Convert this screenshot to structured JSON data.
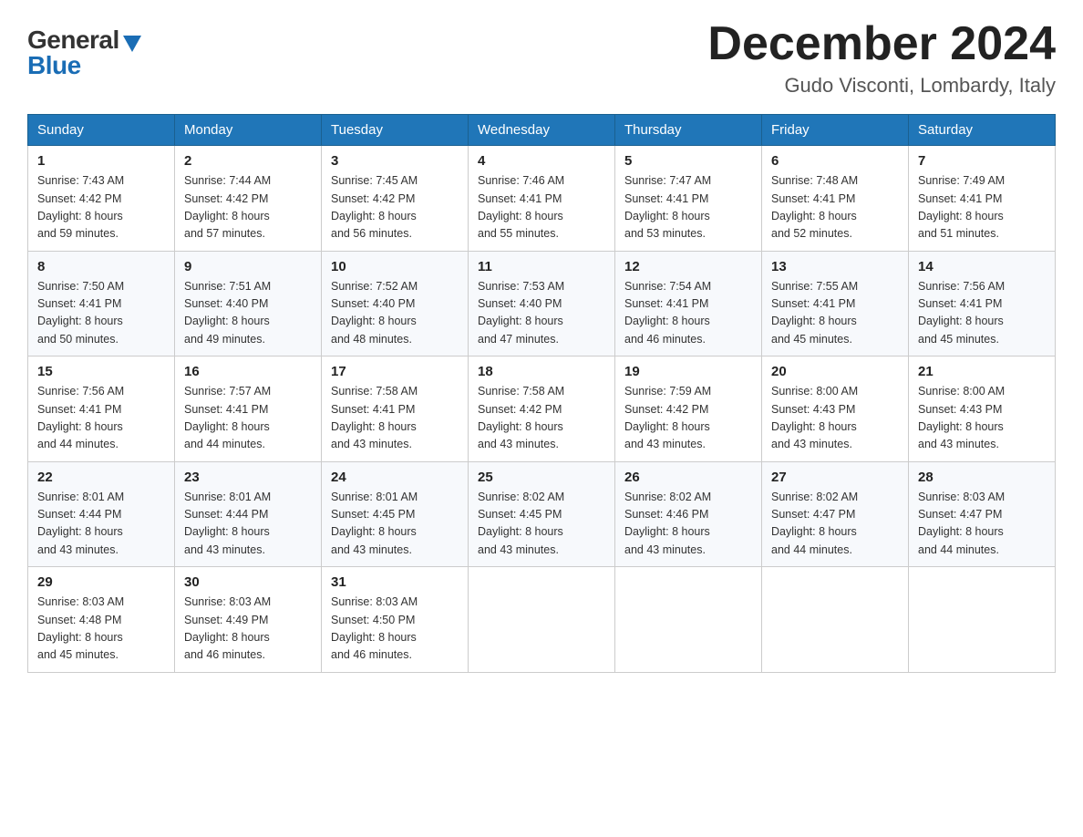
{
  "logo": {
    "general": "General",
    "blue": "Blue"
  },
  "header": {
    "month": "December 2024",
    "location": "Gudo Visconti, Lombardy, Italy"
  },
  "weekdays": [
    "Sunday",
    "Monday",
    "Tuesday",
    "Wednesday",
    "Thursday",
    "Friday",
    "Saturday"
  ],
  "weeks": [
    [
      {
        "day": "1",
        "sunrise": "Sunrise: 7:43 AM",
        "sunset": "Sunset: 4:42 PM",
        "daylight": "Daylight: 8 hours and 59 minutes."
      },
      {
        "day": "2",
        "sunrise": "Sunrise: 7:44 AM",
        "sunset": "Sunset: 4:42 PM",
        "daylight": "Daylight: 8 hours and 57 minutes."
      },
      {
        "day": "3",
        "sunrise": "Sunrise: 7:45 AM",
        "sunset": "Sunset: 4:42 PM",
        "daylight": "Daylight: 8 hours and 56 minutes."
      },
      {
        "day": "4",
        "sunrise": "Sunrise: 7:46 AM",
        "sunset": "Sunset: 4:41 PM",
        "daylight": "Daylight: 8 hours and 55 minutes."
      },
      {
        "day": "5",
        "sunrise": "Sunrise: 7:47 AM",
        "sunset": "Sunset: 4:41 PM",
        "daylight": "Daylight: 8 hours and 53 minutes."
      },
      {
        "day": "6",
        "sunrise": "Sunrise: 7:48 AM",
        "sunset": "Sunset: 4:41 PM",
        "daylight": "Daylight: 8 hours and 52 minutes."
      },
      {
        "day": "7",
        "sunrise": "Sunrise: 7:49 AM",
        "sunset": "Sunset: 4:41 PM",
        "daylight": "Daylight: 8 hours and 51 minutes."
      }
    ],
    [
      {
        "day": "8",
        "sunrise": "Sunrise: 7:50 AM",
        "sunset": "Sunset: 4:41 PM",
        "daylight": "Daylight: 8 hours and 50 minutes."
      },
      {
        "day": "9",
        "sunrise": "Sunrise: 7:51 AM",
        "sunset": "Sunset: 4:40 PM",
        "daylight": "Daylight: 8 hours and 49 minutes."
      },
      {
        "day": "10",
        "sunrise": "Sunrise: 7:52 AM",
        "sunset": "Sunset: 4:40 PM",
        "daylight": "Daylight: 8 hours and 48 minutes."
      },
      {
        "day": "11",
        "sunrise": "Sunrise: 7:53 AM",
        "sunset": "Sunset: 4:40 PM",
        "daylight": "Daylight: 8 hours and 47 minutes."
      },
      {
        "day": "12",
        "sunrise": "Sunrise: 7:54 AM",
        "sunset": "Sunset: 4:41 PM",
        "daylight": "Daylight: 8 hours and 46 minutes."
      },
      {
        "day": "13",
        "sunrise": "Sunrise: 7:55 AM",
        "sunset": "Sunset: 4:41 PM",
        "daylight": "Daylight: 8 hours and 45 minutes."
      },
      {
        "day": "14",
        "sunrise": "Sunrise: 7:56 AM",
        "sunset": "Sunset: 4:41 PM",
        "daylight": "Daylight: 8 hours and 45 minutes."
      }
    ],
    [
      {
        "day": "15",
        "sunrise": "Sunrise: 7:56 AM",
        "sunset": "Sunset: 4:41 PM",
        "daylight": "Daylight: 8 hours and 44 minutes."
      },
      {
        "day": "16",
        "sunrise": "Sunrise: 7:57 AM",
        "sunset": "Sunset: 4:41 PM",
        "daylight": "Daylight: 8 hours and 44 minutes."
      },
      {
        "day": "17",
        "sunrise": "Sunrise: 7:58 AM",
        "sunset": "Sunset: 4:41 PM",
        "daylight": "Daylight: 8 hours and 43 minutes."
      },
      {
        "day": "18",
        "sunrise": "Sunrise: 7:58 AM",
        "sunset": "Sunset: 4:42 PM",
        "daylight": "Daylight: 8 hours and 43 minutes."
      },
      {
        "day": "19",
        "sunrise": "Sunrise: 7:59 AM",
        "sunset": "Sunset: 4:42 PM",
        "daylight": "Daylight: 8 hours and 43 minutes."
      },
      {
        "day": "20",
        "sunrise": "Sunrise: 8:00 AM",
        "sunset": "Sunset: 4:43 PM",
        "daylight": "Daylight: 8 hours and 43 minutes."
      },
      {
        "day": "21",
        "sunrise": "Sunrise: 8:00 AM",
        "sunset": "Sunset: 4:43 PM",
        "daylight": "Daylight: 8 hours and 43 minutes."
      }
    ],
    [
      {
        "day": "22",
        "sunrise": "Sunrise: 8:01 AM",
        "sunset": "Sunset: 4:44 PM",
        "daylight": "Daylight: 8 hours and 43 minutes."
      },
      {
        "day": "23",
        "sunrise": "Sunrise: 8:01 AM",
        "sunset": "Sunset: 4:44 PM",
        "daylight": "Daylight: 8 hours and 43 minutes."
      },
      {
        "day": "24",
        "sunrise": "Sunrise: 8:01 AM",
        "sunset": "Sunset: 4:45 PM",
        "daylight": "Daylight: 8 hours and 43 minutes."
      },
      {
        "day": "25",
        "sunrise": "Sunrise: 8:02 AM",
        "sunset": "Sunset: 4:45 PM",
        "daylight": "Daylight: 8 hours and 43 minutes."
      },
      {
        "day": "26",
        "sunrise": "Sunrise: 8:02 AM",
        "sunset": "Sunset: 4:46 PM",
        "daylight": "Daylight: 8 hours and 43 minutes."
      },
      {
        "day": "27",
        "sunrise": "Sunrise: 8:02 AM",
        "sunset": "Sunset: 4:47 PM",
        "daylight": "Daylight: 8 hours and 44 minutes."
      },
      {
        "day": "28",
        "sunrise": "Sunrise: 8:03 AM",
        "sunset": "Sunset: 4:47 PM",
        "daylight": "Daylight: 8 hours and 44 minutes."
      }
    ],
    [
      {
        "day": "29",
        "sunrise": "Sunrise: 8:03 AM",
        "sunset": "Sunset: 4:48 PM",
        "daylight": "Daylight: 8 hours and 45 minutes."
      },
      {
        "day": "30",
        "sunrise": "Sunrise: 8:03 AM",
        "sunset": "Sunset: 4:49 PM",
        "daylight": "Daylight: 8 hours and 46 minutes."
      },
      {
        "day": "31",
        "sunrise": "Sunrise: 8:03 AM",
        "sunset": "Sunset: 4:50 PM",
        "daylight": "Daylight: 8 hours and 46 minutes."
      },
      {
        "day": "",
        "sunrise": "",
        "sunset": "",
        "daylight": ""
      },
      {
        "day": "",
        "sunrise": "",
        "sunset": "",
        "daylight": ""
      },
      {
        "day": "",
        "sunrise": "",
        "sunset": "",
        "daylight": ""
      },
      {
        "day": "",
        "sunrise": "",
        "sunset": "",
        "daylight": ""
      }
    ]
  ]
}
